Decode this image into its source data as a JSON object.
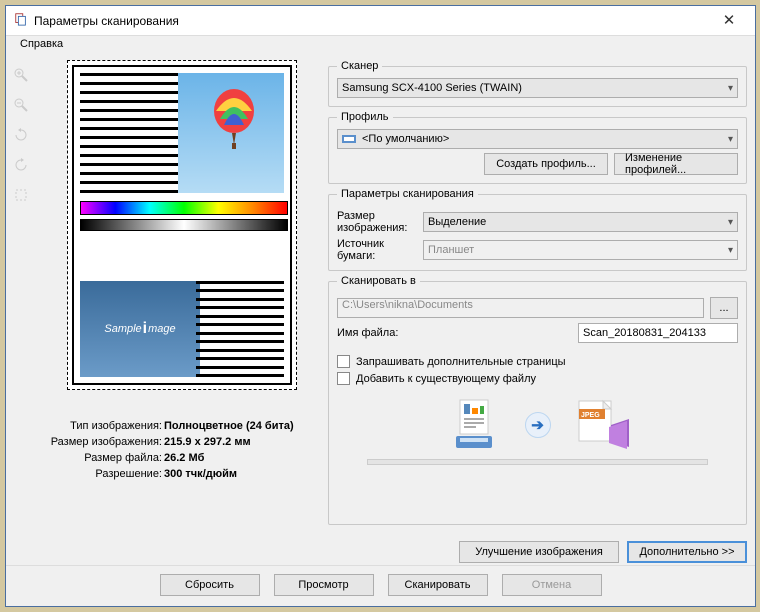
{
  "window": {
    "title": "Параметры сканирования"
  },
  "menu": {
    "help": "Справка"
  },
  "preview": {
    "sample_text": "Sample Image"
  },
  "info": {
    "type_label": "Тип изображения:",
    "type_value": "Полноцветное (24 бита)",
    "size_label": "Размер изображения:",
    "size_value": "215.9 x 297.2 мм",
    "file_label": "Размер файла:",
    "file_value": "26.2 Мб",
    "res_label": "Разрешение:",
    "res_value": "300 тчк/дюйм"
  },
  "scanner": {
    "legend": "Сканер",
    "selected": "Samsung SCX-4100 Series (TWAIN)"
  },
  "profile": {
    "legend": "Профиль",
    "selected": "<По умолчанию>",
    "create_btn": "Создать профиль...",
    "edit_btn": "Изменение профилей..."
  },
  "params": {
    "legend": "Параметры сканирования",
    "image_size_label": "Размер изображения:",
    "image_size_value": "Выделение",
    "paper_source_label": "Источник бумаги:",
    "paper_source_value": "Планшет"
  },
  "scan_to": {
    "legend": "Сканировать в",
    "path": "C:\\Users\\nikna\\Documents",
    "browse_btn": "...",
    "filename_label": "Имя файла:",
    "filename_value": "Scan_20180831_204133",
    "ask_more": "Запрашивать дополнительные страницы",
    "append": "Добавить к существующему файлу",
    "jpeg_badge": "JPEG"
  },
  "actions": {
    "improve": "Улучшение изображения",
    "more": "Дополнительно >>",
    "reset": "Сбросить",
    "preview": "Просмотр",
    "scan": "Сканировать",
    "cancel": "Отмена"
  }
}
